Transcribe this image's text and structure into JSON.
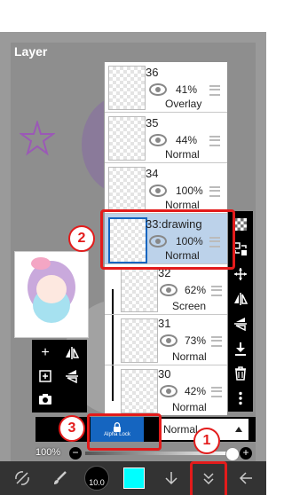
{
  "panel": {
    "title": "Layer"
  },
  "layers": [
    {
      "number": "36",
      "name": "36",
      "opacity": "41%",
      "blend": "Overlay"
    },
    {
      "number": "35",
      "name": "35",
      "opacity": "44%",
      "blend": "Normal"
    },
    {
      "number": "34",
      "name": "34",
      "opacity": "100%",
      "blend": "Normal"
    },
    {
      "number": "33",
      "name": "33:drawing",
      "opacity": "100%",
      "blend": "Normal",
      "selected": true
    },
    {
      "number": "32",
      "name": "32",
      "opacity": "62%",
      "blend": "Screen",
      "clipped": true
    },
    {
      "number": "31",
      "name": "31",
      "opacity": "73%",
      "blend": "Normal",
      "clipped": true
    },
    {
      "number": "30",
      "name": "30",
      "opacity": "42%",
      "blend": "Normal",
      "clipped": true
    }
  ],
  "bottom_strip": {
    "alpha_lock_label": "Alpha Lock",
    "blend_mode": "Normal"
  },
  "opacity_bar": {
    "label": "100%",
    "value": 1.0
  },
  "toolbar": {
    "brush_size": "10.0",
    "color": "#00ffff"
  },
  "annotations": {
    "badge1": "1",
    "badge2": "2",
    "badge3": "3"
  },
  "colors": {
    "selected_row": "#bcd2ea",
    "accent": "#1565c0",
    "annotation": "#e31b1b"
  }
}
